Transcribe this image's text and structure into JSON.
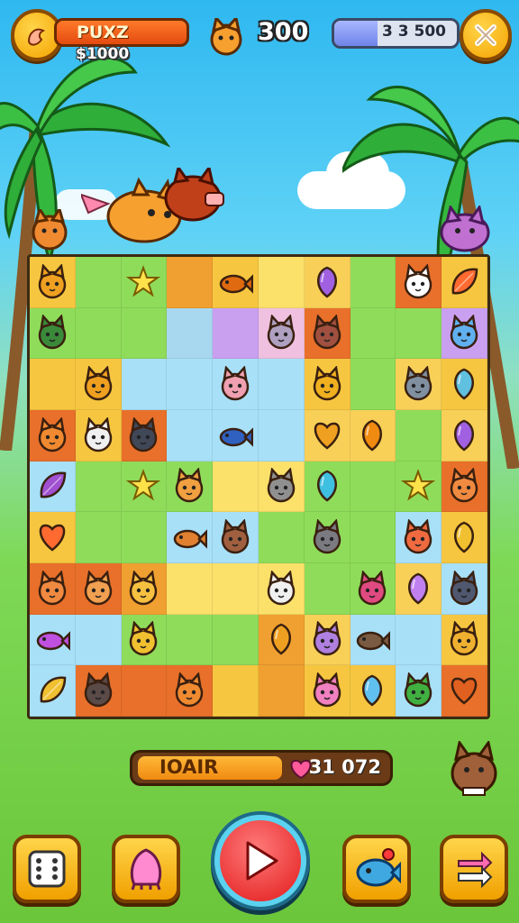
{
  "hud": {
    "player_name": "PUXZ",
    "coins": "$1000",
    "score": "300",
    "progress_text": "3 3 500",
    "progress_fraction": 0.35
  },
  "bottom": {
    "label": "IOAIR",
    "value": "31 072"
  },
  "board": {
    "rows": [
      [
        {
          "bg": "#f6c640",
          "icon": "cat",
          "fill": "#f0a020"
        },
        {
          "bg": "#8fdc5a",
          "icon": "none",
          "fill": ""
        },
        {
          "bg": "#8fdc5a",
          "icon": "star",
          "fill": "#ffe14a"
        },
        {
          "bg": "#f0a030",
          "icon": "none",
          "fill": ""
        },
        {
          "bg": "#f6c640",
          "icon": "fish",
          "fill": "#e06a10"
        },
        {
          "bg": "#fbe06a",
          "icon": "none",
          "fill": ""
        },
        {
          "bg": "#f8d058",
          "icon": "gem",
          "fill": "#a060e0"
        },
        {
          "bg": "#8fdc5a",
          "icon": "none",
          "fill": ""
        },
        {
          "bg": "#e8702a",
          "icon": "cat",
          "fill": "#ffffff"
        },
        {
          "bg": "#f6c640",
          "icon": "leaf",
          "fill": "#ff6a30"
        }
      ],
      [
        {
          "bg": "#8fdc5a",
          "icon": "cat",
          "fill": "#3a8a3a"
        },
        {
          "bg": "#8fdc5a",
          "icon": "none",
          "fill": ""
        },
        {
          "bg": "#8fdc5a",
          "icon": "none",
          "fill": ""
        },
        {
          "bg": "#a8d8f0",
          "icon": "none",
          "fill": ""
        },
        {
          "bg": "#c9a0f0",
          "icon": "none",
          "fill": ""
        },
        {
          "bg": "#f0c0e0",
          "icon": "cat",
          "fill": "#b0a0c0"
        },
        {
          "bg": "#e8702a",
          "icon": "cat",
          "fill": "#a05040"
        },
        {
          "bg": "#8fdc5a",
          "icon": "none",
          "fill": ""
        },
        {
          "bg": "#8fdc5a",
          "icon": "none",
          "fill": ""
        },
        {
          "bg": "#c9a0f0",
          "icon": "cat",
          "fill": "#60b0f0"
        }
      ],
      [
        {
          "bg": "#f6c640",
          "icon": "none",
          "fill": ""
        },
        {
          "bg": "#f6c640",
          "icon": "cat",
          "fill": "#f0a020"
        },
        {
          "bg": "#a8e0f8",
          "icon": "none",
          "fill": ""
        },
        {
          "bg": "#a8e0f8",
          "icon": "none",
          "fill": ""
        },
        {
          "bg": "#a8e0f8",
          "icon": "cat",
          "fill": "#f0a0b0"
        },
        {
          "bg": "#a8e0f8",
          "icon": "none",
          "fill": ""
        },
        {
          "bg": "#f6c640",
          "icon": "cat",
          "fill": "#f0b020"
        },
        {
          "bg": "#8fdc5a",
          "icon": "none",
          "fill": ""
        },
        {
          "bg": "#f8d058",
          "icon": "cat",
          "fill": "#8090a0"
        },
        {
          "bg": "#f6c640",
          "icon": "gem",
          "fill": "#60c0e0"
        }
      ],
      [
        {
          "bg": "#e8702a",
          "icon": "cat",
          "fill": "#f08a30"
        },
        {
          "bg": "#f6c640",
          "icon": "cat",
          "fill": "#f0f0f0"
        },
        {
          "bg": "#e8702a",
          "icon": "cat",
          "fill": "#404858"
        },
        {
          "bg": "#a8e0f8",
          "icon": "none",
          "fill": ""
        },
        {
          "bg": "#a8e0f8",
          "icon": "fish",
          "fill": "#3060c0"
        },
        {
          "bg": "#a8e0f8",
          "icon": "none",
          "fill": ""
        },
        {
          "bg": "#f8d058",
          "icon": "heart",
          "fill": "#f0a020"
        },
        {
          "bg": "#f8d058",
          "icon": "gem",
          "fill": "#f08a10"
        },
        {
          "bg": "#8fdc5a",
          "icon": "none",
          "fill": ""
        },
        {
          "bg": "#f8d058",
          "icon": "gem",
          "fill": "#a060e0"
        }
      ],
      [
        {
          "bg": "#a8e0f8",
          "icon": "leaf",
          "fill": "#a050d0"
        },
        {
          "bg": "#8fdc5a",
          "icon": "none",
          "fill": ""
        },
        {
          "bg": "#8fdc5a",
          "icon": "star",
          "fill": "#ffe14a"
        },
        {
          "bg": "#8fdc5a",
          "icon": "cat",
          "fill": "#f0a040"
        },
        {
          "bg": "#fbe06a",
          "icon": "none",
          "fill": ""
        },
        {
          "bg": "#fbe06a",
          "icon": "cat",
          "fill": "#909090"
        },
        {
          "bg": "#8fdc5a",
          "icon": "gem",
          "fill": "#40c0e0"
        },
        {
          "bg": "#8fdc5a",
          "icon": "none",
          "fill": ""
        },
        {
          "bg": "#8fdc5a",
          "icon": "star",
          "fill": "#ffe14a"
        },
        {
          "bg": "#e8702a",
          "icon": "cat",
          "fill": "#f08a40"
        }
      ],
      [
        {
          "bg": "#f6c640",
          "icon": "heart",
          "fill": "#ff6a30"
        },
        {
          "bg": "#8fdc5a",
          "icon": "none",
          "fill": ""
        },
        {
          "bg": "#8fdc5a",
          "icon": "none",
          "fill": ""
        },
        {
          "bg": "#a8e0f8",
          "icon": "fish",
          "fill": "#e08030"
        },
        {
          "bg": "#a8e0f8",
          "icon": "cat",
          "fill": "#a06040"
        },
        {
          "bg": "#8fdc5a",
          "icon": "none",
          "fill": ""
        },
        {
          "bg": "#8fdc5a",
          "icon": "cat",
          "fill": "#7a7a80"
        },
        {
          "bg": "#8fdc5a",
          "icon": "none",
          "fill": ""
        },
        {
          "bg": "#a8e0f8",
          "icon": "cat",
          "fill": "#f06a40"
        },
        {
          "bg": "#f6c640",
          "icon": "gem",
          "fill": "#f0c030"
        }
      ],
      [
        {
          "bg": "#e8702a",
          "icon": "cat",
          "fill": "#f08a40"
        },
        {
          "bg": "#e8702a",
          "icon": "cat",
          "fill": "#f0a050"
        },
        {
          "bg": "#f0a030",
          "icon": "cat",
          "fill": "#f6c040"
        },
        {
          "bg": "#fbe06a",
          "icon": "none",
          "fill": ""
        },
        {
          "bg": "#fbe06a",
          "icon": "none",
          "fill": ""
        },
        {
          "bg": "#fbe06a",
          "icon": "cat",
          "fill": "#f0f0f0"
        },
        {
          "bg": "#8fdc5a",
          "icon": "none",
          "fill": ""
        },
        {
          "bg": "#8fdc5a",
          "icon": "cat",
          "fill": "#e04a80"
        },
        {
          "bg": "#f8d058",
          "icon": "gem",
          "fill": "#c080f0"
        },
        {
          "bg": "#a8e0f8",
          "icon": "cat",
          "fill": "#505870"
        }
      ],
      [
        {
          "bg": "#a8e0f8",
          "icon": "fish",
          "fill": "#c050e0"
        },
        {
          "bg": "#a8e0f8",
          "icon": "none",
          "fill": ""
        },
        {
          "bg": "#8fdc5a",
          "icon": "cat",
          "fill": "#f0c030"
        },
        {
          "bg": "#8fdc5a",
          "icon": "none",
          "fill": ""
        },
        {
          "bg": "#8fdc5a",
          "icon": "none",
          "fill": ""
        },
        {
          "bg": "#f0a030",
          "icon": "gem",
          "fill": "#f0a020"
        },
        {
          "bg": "#f8d058",
          "icon": "cat",
          "fill": "#b080e0"
        },
        {
          "bg": "#a8e0f8",
          "icon": "fish",
          "fill": "#7a5a40"
        },
        {
          "bg": "#a8e0f8",
          "icon": "none",
          "fill": ""
        },
        {
          "bg": "#f6c640",
          "icon": "cat",
          "fill": "#f0b030"
        }
      ],
      [
        {
          "bg": "#a8e0f8",
          "icon": "leaf",
          "fill": "#f0c030"
        },
        {
          "bg": "#e8702a",
          "icon": "cat",
          "fill": "#5a4a48"
        },
        {
          "bg": "#e8702a",
          "icon": "none",
          "fill": ""
        },
        {
          "bg": "#e8702a",
          "icon": "cat",
          "fill": "#f08a30"
        },
        {
          "bg": "#f6c640",
          "icon": "none",
          "fill": ""
        },
        {
          "bg": "#f0a030",
          "icon": "none",
          "fill": ""
        },
        {
          "bg": "#f6c640",
          "icon": "cat",
          "fill": "#f080c0"
        },
        {
          "bg": "#f6c640",
          "icon": "gem",
          "fill": "#60c0f0"
        },
        {
          "bg": "#a8e0f8",
          "icon": "cat",
          "fill": "#40b040"
        },
        {
          "bg": "#e8702a",
          "icon": "heart",
          "fill": "#e06020"
        }
      ]
    ]
  },
  "colors": {
    "hud_gold": "#f5a300",
    "name_bar": "#e34b10",
    "progress_fill": "#6f84e8",
    "play_red": "#e21a1a",
    "board_border": "#3b2a12"
  },
  "icons": {
    "menu_icon": "paw-icon",
    "close_icon": "close-icon",
    "score_icon": "cat-head-icon",
    "tool_1": "dice-icon",
    "tool_2": "pink-creature-icon",
    "play": "play-icon",
    "tool_4": "blue-fish-icon",
    "tool_5": "swap-arrows-icon"
  }
}
